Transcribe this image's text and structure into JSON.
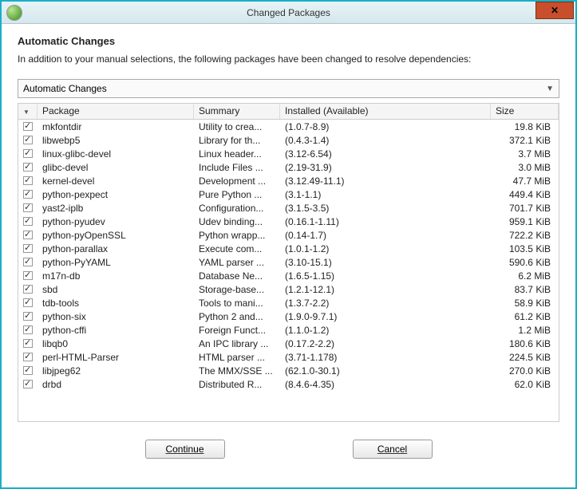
{
  "window": {
    "title": "Changed Packages",
    "close_glyph": "✕"
  },
  "heading": "Automatic Changes",
  "subtext": "In addition to your manual selections, the following packages have been changed to resolve dependencies:",
  "combo": {
    "label": "Automatic Changes"
  },
  "columns": {
    "package": "Package",
    "summary": "Summary",
    "installed": "Installed (Available)",
    "size": "Size"
  },
  "rows": [
    {
      "pkg": "mkfontdir",
      "sum": "Utility to crea...",
      "inst": "(1.0.7-8.9)",
      "size": "19.8 KiB"
    },
    {
      "pkg": "libwebp5",
      "sum": "Library for th...",
      "inst": "(0.4.3-1.4)",
      "size": "372.1 KiB"
    },
    {
      "pkg": "linux-glibc-devel",
      "sum": "Linux header...",
      "inst": "(3.12-6.54)",
      "size": "3.7 MiB"
    },
    {
      "pkg": "glibc-devel",
      "sum": "Include Files ...",
      "inst": "(2.19-31.9)",
      "size": "3.0 MiB"
    },
    {
      "pkg": "kernel-devel",
      "sum": "Development ...",
      "inst": "(3.12.49-11.1)",
      "size": "47.7 MiB"
    },
    {
      "pkg": "python-pexpect",
      "sum": "Pure Python ...",
      "inst": "(3.1-1.1)",
      "size": "449.4 KiB"
    },
    {
      "pkg": "yast2-iplb",
      "sum": "Configuration...",
      "inst": "(3.1.5-3.5)",
      "size": "701.7 KiB"
    },
    {
      "pkg": "python-pyudev",
      "sum": "Udev binding...",
      "inst": "(0.16.1-1.11)",
      "size": "959.1 KiB"
    },
    {
      "pkg": "python-pyOpenSSL",
      "sum": "Python wrapp...",
      "inst": "(0.14-1.7)",
      "size": "722.2 KiB"
    },
    {
      "pkg": "python-parallax",
      "sum": "Execute com...",
      "inst": "(1.0.1-1.2)",
      "size": "103.5 KiB"
    },
    {
      "pkg": "python-PyYAML",
      "sum": "YAML parser ...",
      "inst": "(3.10-15.1)",
      "size": "590.6 KiB"
    },
    {
      "pkg": "m17n-db",
      "sum": "Database Ne...",
      "inst": "(1.6.5-1.15)",
      "size": "6.2 MiB"
    },
    {
      "pkg": "sbd",
      "sum": "Storage-base...",
      "inst": "(1.2.1-12.1)",
      "size": "83.7 KiB"
    },
    {
      "pkg": "tdb-tools",
      "sum": "Tools to mani...",
      "inst": "(1.3.7-2.2)",
      "size": "58.9 KiB"
    },
    {
      "pkg": "python-six",
      "sum": "Python 2 and...",
      "inst": "(1.9.0-9.7.1)",
      "size": "61.2 KiB"
    },
    {
      "pkg": "python-cffi",
      "sum": "Foreign Funct...",
      "inst": "(1.1.0-1.2)",
      "size": "1.2 MiB"
    },
    {
      "pkg": "libqb0",
      "sum": "An IPC library ...",
      "inst": "(0.17.2-2.2)",
      "size": "180.6 KiB"
    },
    {
      "pkg": "perl-HTML-Parser",
      "sum": "HTML parser ...",
      "inst": "(3.71-1.178)",
      "size": "224.5 KiB"
    },
    {
      "pkg": "libjpeg62",
      "sum": "The MMX/SSE ...",
      "inst": "(62.1.0-30.1)",
      "size": "270.0 KiB"
    },
    {
      "pkg": "drbd",
      "sum": "Distributed R...",
      "inst": "(8.4.6-4.35)",
      "size": "62.0 KiB"
    }
  ],
  "buttons": {
    "continue": "Continue",
    "cancel": "Cancel"
  }
}
